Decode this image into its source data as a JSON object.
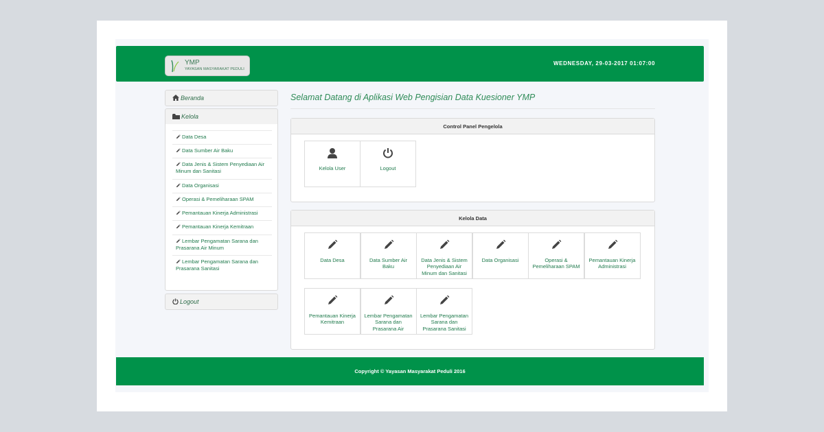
{
  "header": {
    "logo_title": "YMP",
    "logo_subtitle": "YAYASAN MASYARAKAT PEDULI",
    "datetime": "WEDNESDAY, 29-03-2017 01:07:00"
  },
  "sidebar": {
    "beranda": "Beranda",
    "kelola": "Kelola",
    "logout": "Logout",
    "items": [
      "Data Desa",
      "Data Sumber Air Baku",
      "Data Jenis & Sistem Penyediaan Air Minum dan Sanitasi",
      "Data Organisasi",
      "Operasi & Pemeliharaan SPAM",
      "Pemantauan Kinerja Administrasi",
      "Pemantauan Kinerja Kemitraan",
      "Lembar Pengamatan Sarana dan Prasarana Air Minum",
      "Lembar Pengamatan Sarana dan Prasarana Sanitasi"
    ]
  },
  "main": {
    "welcome": "Selamat Datang di Aplikasi Web Pengisian Data Kuesioner YMP",
    "control_panel": {
      "title": "Control Panel Pengelola",
      "tiles": [
        "Kelola User",
        "Logout"
      ]
    },
    "kelola_data": {
      "title": "Kelola Data",
      "tiles": [
        "Data Desa",
        "Data Sumber Air Baku",
        "Data Jenis & Sistem Penyediaan Air Minum dan Sanitasi",
        "Data Organisasi",
        "Operasi & Pemeliharaan SPAM",
        "Pemantauan Kinerja Administrasi",
        "Pemantauan Kinerja Kemitraan",
        "Lembar Pengamatan Sarana dan Prasarana Air",
        "Lembar Pengamatan Sarana dan Prasarana Sanitasi"
      ]
    }
  },
  "footer": {
    "copyright": "Copyright © Yayasan Masyarakat Peduli 2016"
  },
  "icons": {
    "home": "home-icon",
    "folder": "folder-icon",
    "pencil": "pencil-icon",
    "power": "power-icon",
    "user": "user-icon"
  },
  "colors": {
    "brand_green": "#00924a",
    "link_green": "#1f7a4c"
  }
}
